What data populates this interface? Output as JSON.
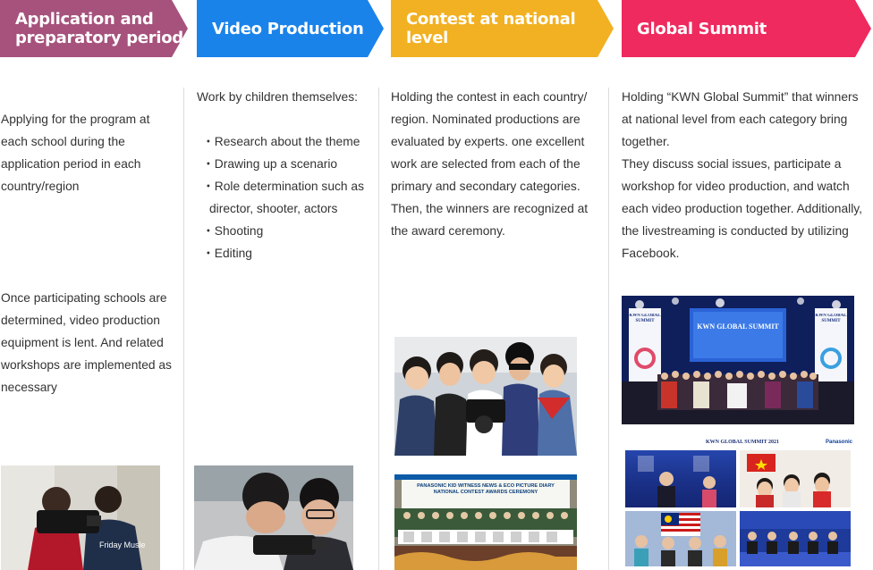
{
  "steps": [
    {
      "title": "Application and\npreparatory period",
      "color": "#a6527c",
      "paragraphs": [
        "Applying for the program at each school during the application period in each country/region",
        "Once participating schools are determined, video production equipment is lent. And related workshops are implemented as necessary"
      ]
    },
    {
      "title": "Video Production",
      "color": "#1a83ea",
      "intro": "Work by children themselves:",
      "bullets": [
        "Research about the theme",
        "Drawing up a scenario",
        "Role determination such as director, shooter, actors",
        "Shooting",
        "Editing"
      ]
    },
    {
      "title": "Contest at national level",
      "color": "#f2b122",
      "text": "Holding the contest in each country/ region. Nominated productions are evaluated by experts. one excellent work are selected from each of the primary and secondary categories. Then, the winners are recognized at the award ceremony."
    },
    {
      "title": "Global Summit",
      "color": "#ef2a5e",
      "text": "Holding “KWN Global Summit” that winners at national level from each category bring together.\nThey discuss social issues, participate a workshop for video production, and watch each video production together. Additionally, the livestreaming is conducted by utilizing Facebook."
    }
  ],
  "photos": {
    "summit_screen": "KWN GLOBAL SUMMIT",
    "summit_side_left": "KWN GLOBAL SUMMIT",
    "summit_side_right": "KWN GLOBAL SUMMIT",
    "online_header": "KWN GLOBAL SUMMIT 2021",
    "online_brand": "Panasonic",
    "ceremony_banner": "PANASONIC KID WITNESS NEWS & ECO PICTURE DIARY NATIONAL CONTEST AWARDS CEREMONY",
    "student_shirt": "Friday Musle"
  }
}
